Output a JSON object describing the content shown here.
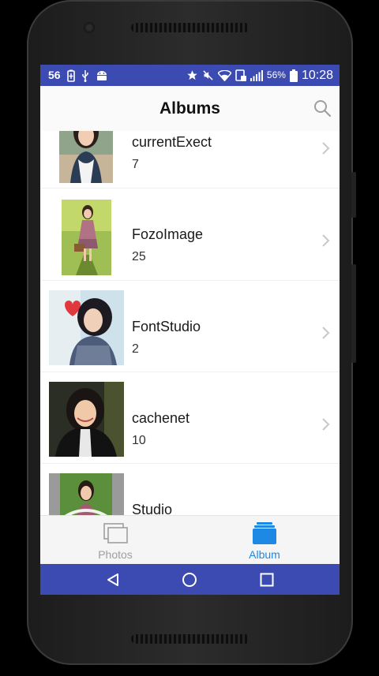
{
  "status_bar": {
    "notification_count": "56",
    "battery_percent": "56%",
    "time": "10:28",
    "left_icons": [
      "battery-saver-icon",
      "usb-icon",
      "android-icon"
    ],
    "right_icons": [
      "star-icon",
      "mute-icon",
      "wifi-icon",
      "data-saver-icon",
      "signal-icon",
      "battery-icon"
    ]
  },
  "header": {
    "title": "Albums",
    "search_icon": "search-icon"
  },
  "albums": [
    {
      "name": "currentExect",
      "count": "7"
    },
    {
      "name": "FozoImage",
      "count": "25"
    },
    {
      "name": "FontStudio",
      "count": "2"
    },
    {
      "name": "cachenet",
      "count": "10"
    },
    {
      "name": "Studio",
      "count": ""
    }
  ],
  "bottom_nav": {
    "tabs": [
      {
        "label": "Photos",
        "icon": "photos-icon",
        "active": false
      },
      {
        "label": "Album",
        "icon": "album-icon",
        "active": true
      }
    ]
  },
  "system_nav": [
    "back-icon",
    "home-icon",
    "recents-icon"
  ],
  "colors": {
    "accent": "#3b4bb2",
    "tab_active": "#1e88e5",
    "tab_inactive": "#9e9e9e"
  }
}
